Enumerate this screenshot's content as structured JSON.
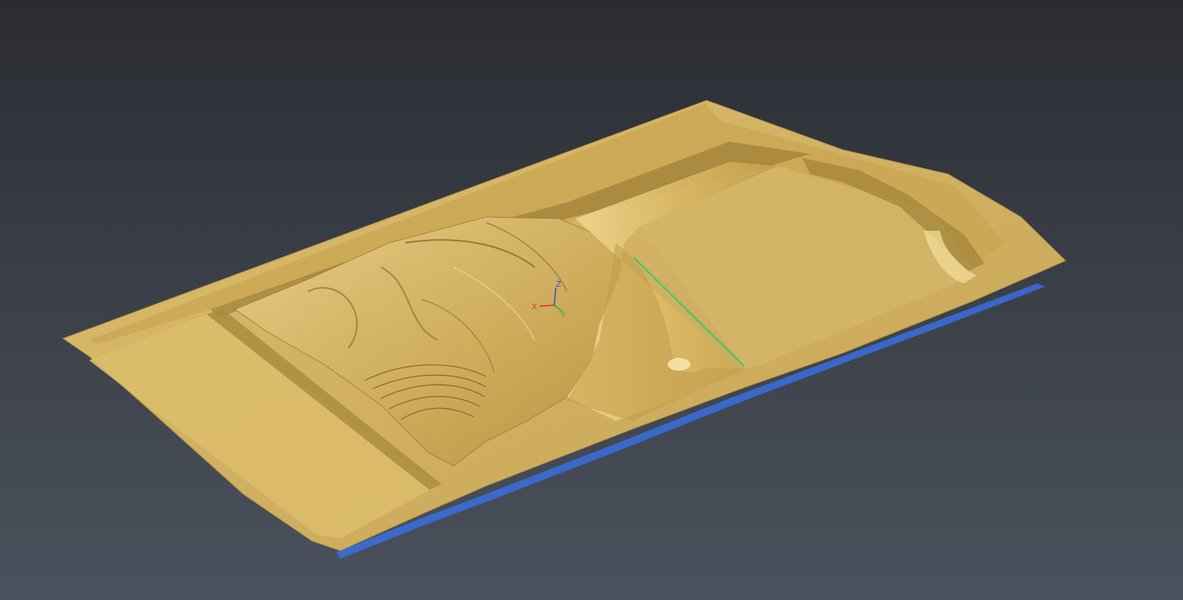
{
  "viewport": {
    "background_top": "#2a2c31",
    "background_bottom": "#4b525d"
  },
  "mesh": {
    "surface_color": "#d9b764",
    "shadow_color": "#a88a3e",
    "highlight_color": "#efd58c",
    "backface_color": "#3a6fe0",
    "section_line_color": "#3ec86a"
  },
  "triad": {
    "x_label": "X",
    "y_label": "Y",
    "z_label": "Z",
    "x_color": "#e03030",
    "y_color": "#30b040",
    "z_color": "#3a4fd8"
  }
}
